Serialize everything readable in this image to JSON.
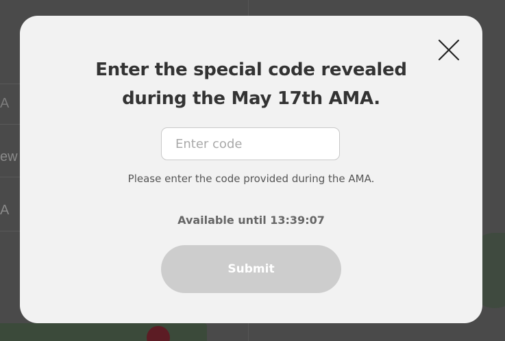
{
  "background": {
    "row_fragments": [
      "A",
      "ew",
      "A"
    ]
  },
  "modal": {
    "title_line1": "Enter the special code revealed",
    "title_line2": "during the May 17th AMA.",
    "code_input": {
      "placeholder": "Enter code",
      "value": ""
    },
    "helper_text": "Please enter the code provided during the AMA.",
    "availability_text": "Available until 13:39:07",
    "submit_label": "Submit"
  },
  "colors": {
    "modal_bg": "#f2f2f2",
    "submit_disabled_bg": "#cdcdcd",
    "title_text": "#333333"
  },
  "icons": {
    "close": "close-icon"
  }
}
